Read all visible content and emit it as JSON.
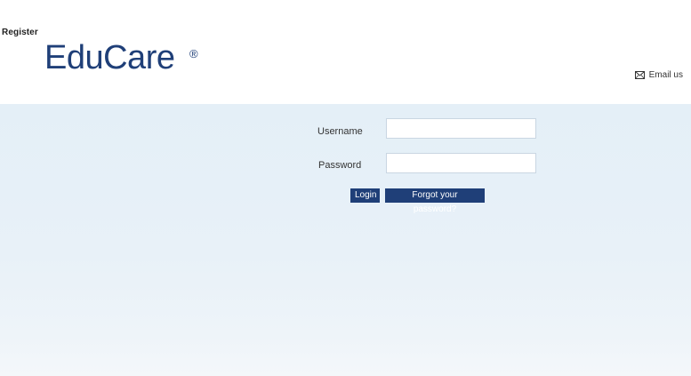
{
  "header": {
    "register_label": "Register",
    "logo_text": "EduCare",
    "logo_mark": "®",
    "email_label": "Email us",
    "email_icon": "envelope-icon"
  },
  "login_form": {
    "username_label": "Username",
    "username_value": "",
    "password_label": "Password",
    "password_value": "",
    "login_button": "Login",
    "forgot_button": "Forgot your password?"
  },
  "colors": {
    "brand": "#1f3f78",
    "background": "#e4eff7"
  }
}
